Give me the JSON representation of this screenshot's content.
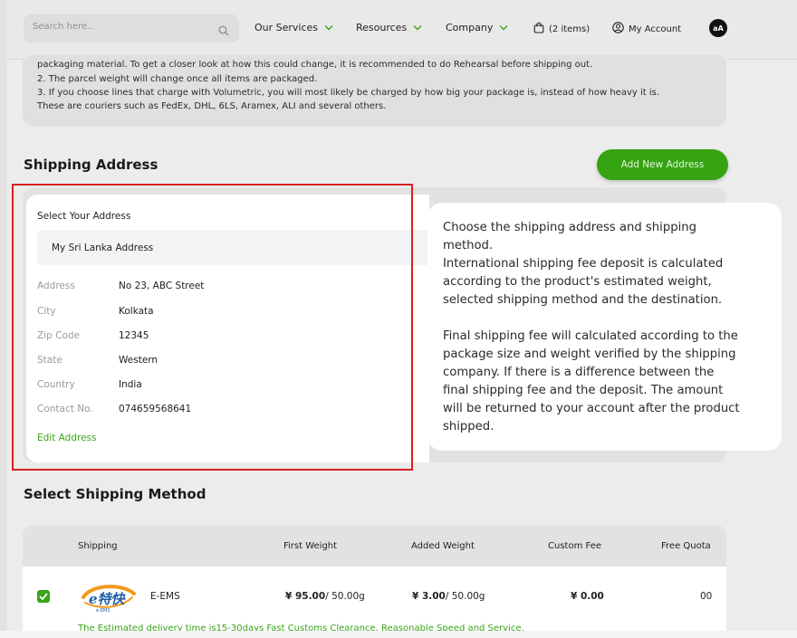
{
  "header": {
    "search_placeholder": "Search here..",
    "nav": [
      {
        "label": "Our Services",
        "has_dropdown": true
      },
      {
        "label": "Resources",
        "has_dropdown": true
      },
      {
        "label": "Company",
        "has_dropdown": true
      }
    ],
    "cart_label": "(2 items)",
    "account_label": "My Account",
    "avatar_initials": "aA"
  },
  "notes": {
    "lines": [
      "packaging material. To get a closer look at how this could change, it is recommended to do Rehearsal before shipping out.",
      "2. The parcel weight will change once all items are packaged.",
      "3. If you choose lines that charge with Volumetric, you will most likely be charged by how big your package is, instead of how heavy it is.",
      "These are couriers such as FedEx, DHL, 6LS, Aramex, ALI and several others."
    ]
  },
  "shipping_address": {
    "title": "Shipping Address",
    "add_button": "Add New Address",
    "select_label": "Select Your Address",
    "selected_address": "My Sri Lanka Address",
    "fields": [
      {
        "key": "Address",
        "value": "No 23, ABC Street"
      },
      {
        "key": "City",
        "value": "Kolkata"
      },
      {
        "key": "Zip Code",
        "value": "12345"
      },
      {
        "key": "State",
        "value": "Western"
      },
      {
        "key": "Country",
        "value": "India"
      },
      {
        "key": "Contact No.",
        "value": "074659568641"
      }
    ],
    "edit_link": "Edit Address"
  },
  "tooltip": {
    "lines": [
      "Choose the shipping address and shipping",
      "method.",
      "International shipping fee deposit is calculated",
      "according to the product's estimated weight,",
      "selected shipping method and the destination.",
      "",
      "Final shipping fee will calculated according to the",
      "package size and weight verified by the shipping",
      "company. If there is a difference between the",
      "final shipping fee and the deposit. The amount",
      "will be returned to your account after the product",
      "shipped."
    ]
  },
  "shipping_method": {
    "title": "Select Shipping Method",
    "columns": [
      "Shipping",
      "First Weight",
      "Added Weight",
      "Custom Fee",
      "Free Quota"
    ],
    "rows": [
      {
        "checked": true,
        "logo_text": "e特快",
        "logo_subtext": "e-EMS",
        "name": "E-EMS",
        "first_weight_price": "¥ 95.00",
        "first_weight_unit": "/ 50.00g",
        "added_weight_price": "¥ 3.00",
        "added_weight_unit": "/ 50.00g",
        "custom_fee": "¥ 0.00",
        "free_quota": "00",
        "delivery_note": "The Estimated delivery time is15-30days Fast Customs Clearance, Reasonable Speed and Service."
      }
    ]
  },
  "colors": {
    "accent_green": "#35a312",
    "highlight_red": "#d8201f",
    "page_bg": "#ececec"
  }
}
